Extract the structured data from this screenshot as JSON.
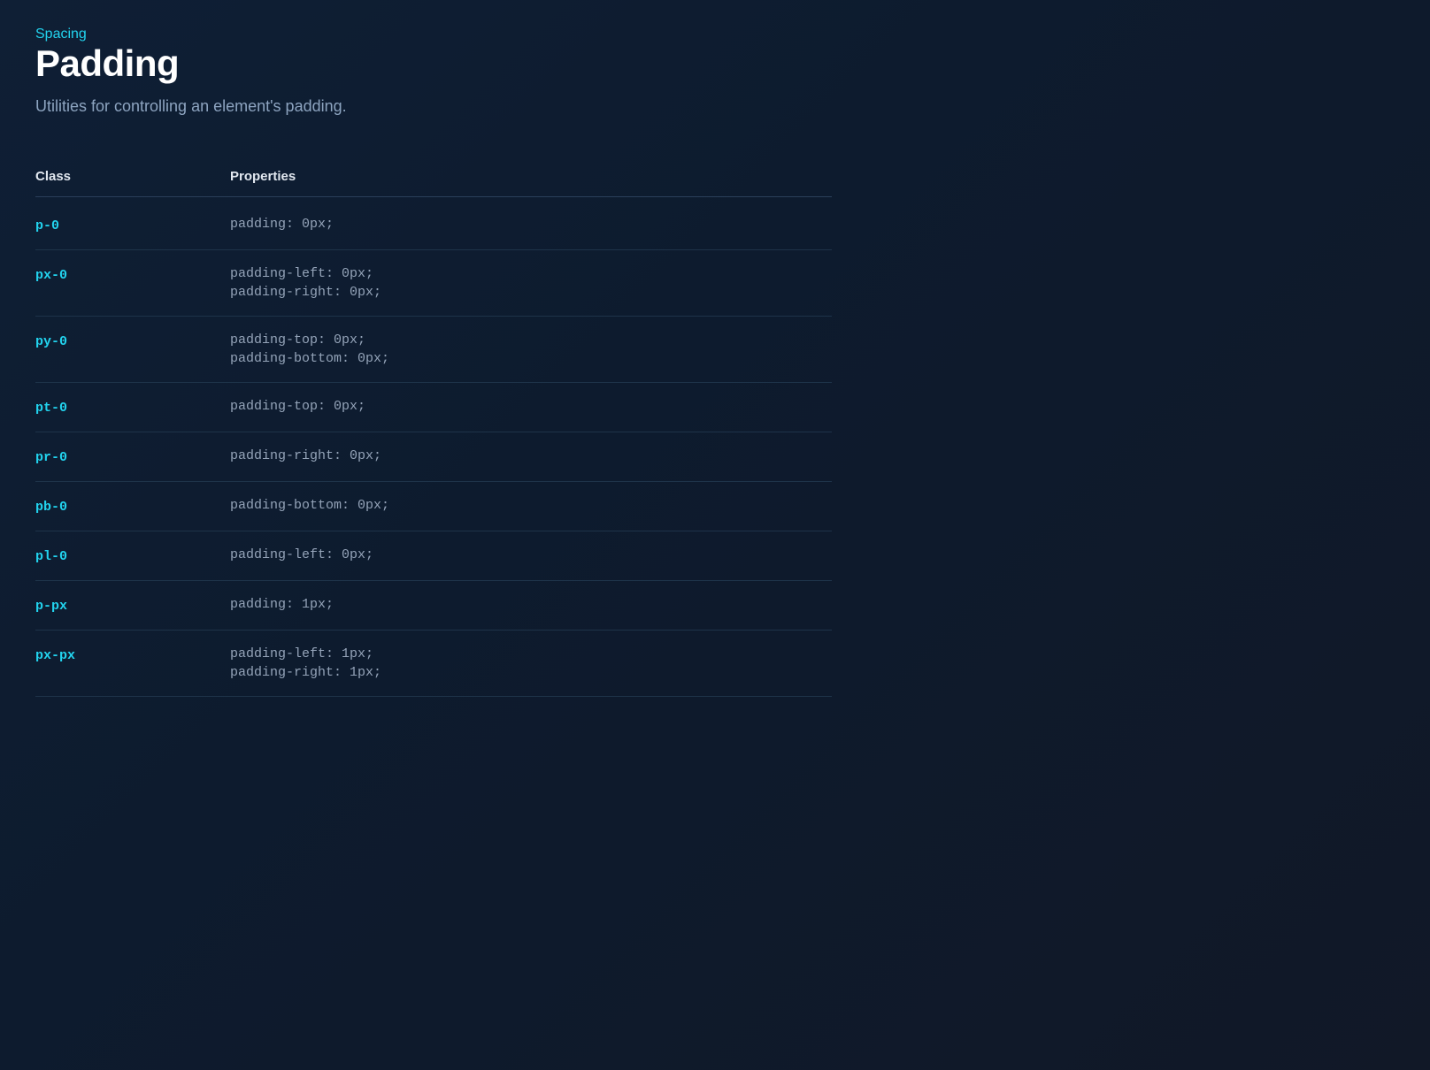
{
  "breadcrumb": {
    "label": "Spacing"
  },
  "page": {
    "title": "Padding",
    "description": "Utilities for controlling an element's padding."
  },
  "table": {
    "headers": {
      "class": "Class",
      "properties": "Properties"
    },
    "rows": [
      {
        "class": "p-0",
        "properties": [
          "padding: 0px;"
        ]
      },
      {
        "class": "px-0",
        "properties": [
          "padding-left: 0px;",
          "padding-right: 0px;"
        ]
      },
      {
        "class": "py-0",
        "properties": [
          "padding-top: 0px;",
          "padding-bottom: 0px;"
        ]
      },
      {
        "class": "pt-0",
        "properties": [
          "padding-top: 0px;"
        ]
      },
      {
        "class": "pr-0",
        "properties": [
          "padding-right: 0px;"
        ]
      },
      {
        "class": "pb-0",
        "properties": [
          "padding-bottom: 0px;"
        ]
      },
      {
        "class": "pl-0",
        "properties": [
          "padding-left: 0px;"
        ]
      },
      {
        "class": "p-px",
        "properties": [
          "padding: 1px;"
        ]
      },
      {
        "class": "px-px",
        "properties": [
          "padding-left: 1px;",
          "padding-right: 1px;"
        ]
      }
    ]
  }
}
